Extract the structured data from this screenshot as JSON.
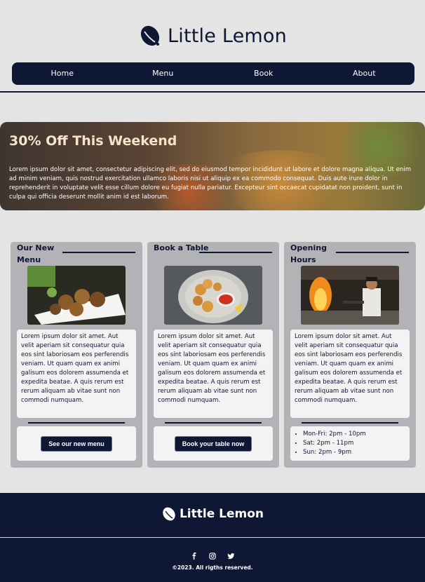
{
  "header": {
    "brand_name": "Little Lemon",
    "logo_icon": "lemon-icon",
    "nav": [
      "Home",
      "Menu",
      "Book",
      "About"
    ]
  },
  "hero": {
    "title": "30% Off This Weekend",
    "text": "Lorem ipsum dolor sit amet, consectetur adipiscing elit, sed do eiusmod tempor incididunt ut labore et dolore magna aliqua. Ut enim ad minim veniam, quis nostrud exercitation ullamco laboris nisi ut aliquip ex ea commodo consequat. Duis aute irure dolor in reprehenderit in voluptate velit esse cillum dolore eu fugiat nulla pariatur. Excepteur sint occaecat cupidatat non proident, sunt in culpa qui officia deserunt mollit anim id est laborum."
  },
  "cards": [
    {
      "title": "Our New Menu",
      "image": "falafel-plate",
      "description": "Lorem ipsum dolor sit amet. Aut velit aperiam sit consequatur quia eos sint laboriosam eos perferendis veniam. Ut quam quam ex animi galisum eos dolorem assumenda et expedita beatae. A quis rerum est rerum aliquam ab vitae sunt non commodi numquam.",
      "button": "See our new menu"
    },
    {
      "title": "Book a Table",
      "image": "calamari-plate",
      "description": "Lorem ipsum dolor sit amet. Aut velit aperiam sit consequatur quia eos sint laboriosam eos perferendis veniam. Ut quam quam ex animi galisum eos dolorem assumenda et expedita beatae. A quis rerum est rerum aliquam ab vitae sunt non commodi numquam.",
      "button": "Book your table now"
    },
    {
      "title": "Opening Hours",
      "image": "chef-kitchen",
      "description": "Lorem ipsum dolor sit amet. Aut velit aperiam sit consequatur quia eos sint laboriosam eos perferendis veniam. Ut quam quam ex animi galisum eos dolorem assumenda et expedita beatae. A quis rerum est rerum aliquam ab vitae sunt non commodi numquam.",
      "hours": [
        "Mon-Fri: 2pm - 10pm",
        "Sat: 2pm - 11pm",
        "Sun: 2pm - 9pm"
      ]
    }
  ],
  "footer": {
    "brand_name": "Little Lemon",
    "social_icons": [
      "facebook-icon",
      "instagram-icon",
      "twitter-icon"
    ],
    "copyright": "©2023. All rigths reserved."
  },
  "colors": {
    "navy": "#0e1734",
    "background": "#e4e4e4",
    "card": "#b3b2b6",
    "hero_title": "#f6e4c8"
  }
}
